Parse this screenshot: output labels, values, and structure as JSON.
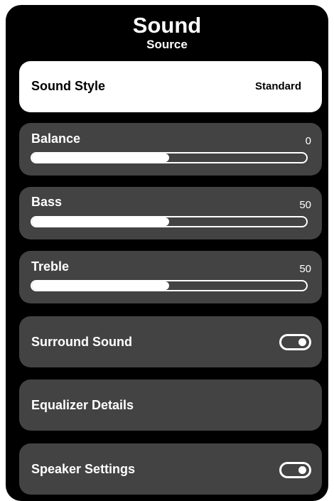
{
  "header": {
    "title": "Sound",
    "subtitle": "Source"
  },
  "sound_style": {
    "label": "Sound Style",
    "value": "Standard"
  },
  "balance": {
    "label": "Balance",
    "value": "0",
    "fill_fraction": 0.5
  },
  "bass": {
    "label": "Bass",
    "value": "50",
    "fill_fraction": 0.5
  },
  "treble": {
    "label": "Treble",
    "value": "50",
    "fill_fraction": 0.5
  },
  "surround_sound": {
    "label": "Surround Sound",
    "toggle_on": true
  },
  "equalizer_details": {
    "label": "Equalizer Details"
  },
  "speaker_settings": {
    "label": "Speaker Settings",
    "toggle_on": true
  },
  "colors": {
    "panel_background": "#000000",
    "card_background": "#434343",
    "selected_card_background": "#ffffff",
    "text": "#ffffff"
  }
}
